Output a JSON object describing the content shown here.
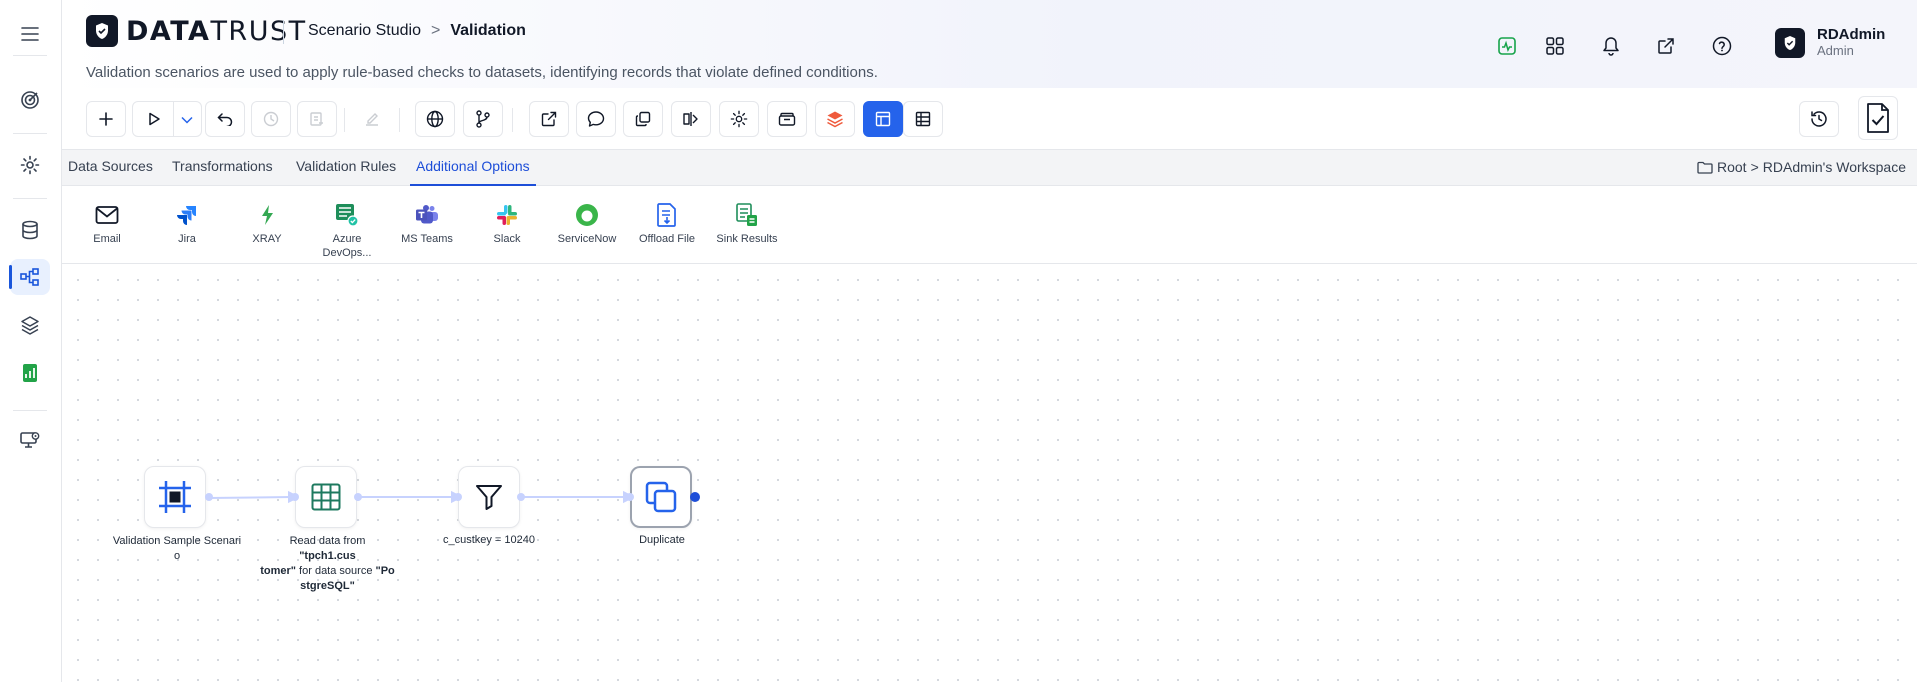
{
  "app": {
    "logo_text_a": "DATA",
    "logo_text_b": "TRUST"
  },
  "breadcrumb": {
    "parent": "Scenario Studio",
    "separator": ">",
    "current": "Validation"
  },
  "subtitle": "Validation scenarios are used to apply rule-based checks to datasets, identifying records that violate defined conditions.",
  "header_icons": [
    "activity-icon",
    "apps-grid-icon",
    "bell-icon",
    "external-link-icon",
    "help-icon"
  ],
  "user": {
    "name": "RDAdmin",
    "role": "Admin"
  },
  "left_rail": [
    "menu-icon",
    "target-icon",
    "settings-icon",
    "database-icon",
    "workflow-icon",
    "layers-icon",
    "report-icon",
    "monitor-settings-icon"
  ],
  "tabs": [
    {
      "label": "Data Sources"
    },
    {
      "label": "Transformations"
    },
    {
      "label": "Validation Rules"
    },
    {
      "label": "Additional Options",
      "active": true
    }
  ],
  "workspace": {
    "root": "Root",
    "separator": ">",
    "name": "RDAdmin's Workspace"
  },
  "options": [
    {
      "label": "Email",
      "icon": "mail-icon"
    },
    {
      "label": "Jira",
      "icon": "jira-icon"
    },
    {
      "label": "XRAY",
      "icon": "xray-icon"
    },
    {
      "label": "Azure DevOps...",
      "label_line1": "Azure",
      "label_line2": "DevOps...",
      "icon": "azure-devops-icon"
    },
    {
      "label": "MS Teams",
      "icon": "teams-icon"
    },
    {
      "label": "Slack",
      "icon": "slack-icon"
    },
    {
      "label": "ServiceNow",
      "icon": "servicenow-icon"
    },
    {
      "label": "Offload File",
      "icon": "offload-file-icon"
    },
    {
      "label": "Sink Results",
      "icon": "sink-results-icon"
    }
  ],
  "flow_nodes": [
    {
      "id": "start",
      "label_line1": "Validation Sample Scenari",
      "label_line2": "o",
      "icon": "frame-icon"
    },
    {
      "id": "read",
      "label_pre": "Read data from ",
      "table_a": "\"tpch1.cus",
      "table_b": "tomer\"",
      "mid": " for data source ",
      "source_a": "\"Po",
      "source_b": "stgreSQL\"",
      "icon": "table-icon"
    },
    {
      "id": "filter",
      "label": "c_custkey = 10240",
      "icon": "filter-icon"
    },
    {
      "id": "duplicate",
      "label": "Duplicate",
      "icon": "duplicate-icon"
    }
  ],
  "colors": {
    "accent": "#2563eb",
    "active_tab": "#1d4ed8",
    "rail_active_bg": "#e8f0fe",
    "node_icon": "#2563eb",
    "table_icon": "#1e7a5f",
    "edge": "#c7d2fe"
  }
}
